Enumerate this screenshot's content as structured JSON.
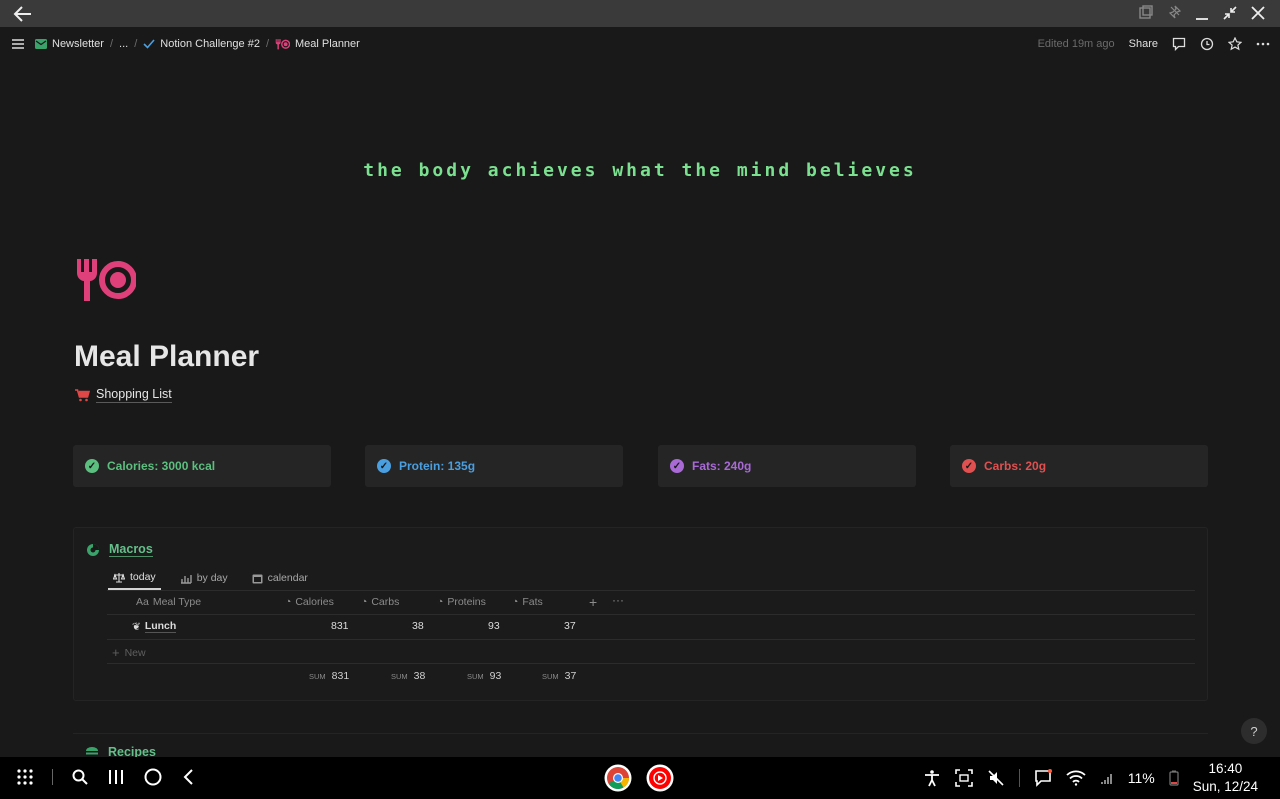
{
  "topbar": {
    "breadcrumbs": [
      "Newsletter",
      "...",
      "Notion Challenge #2",
      "Meal Planner"
    ],
    "edited": "Edited 19m ago",
    "share_label": "Share"
  },
  "cover": {
    "quote": "the body achieves what the mind believes"
  },
  "page": {
    "title": "Meal Planner",
    "link": "Shopping List",
    "icon": "fork-plate-icon"
  },
  "stats": [
    {
      "label": "Calories: 3000 kcal",
      "color": "#5cbf7f"
    },
    {
      "label": "Protein: 135g",
      "color": "#4a9fe0"
    },
    {
      "label": "Fats: 240g",
      "color": "#a96ad6"
    },
    {
      "label": "Carbs: 20g",
      "color": "#e05050"
    }
  ],
  "macros": {
    "title": "Macros",
    "views": [
      "today",
      "by day",
      "calendar"
    ],
    "columns": [
      "Meal Type",
      "Calories",
      "Carbs",
      "Proteins",
      "Fats"
    ],
    "rows": [
      {
        "meal": "Lunch",
        "calories": "831",
        "carbs": "38",
        "proteins": "93",
        "fats": "37"
      }
    ],
    "new_label": "New",
    "sum_label": "SUM",
    "sums": {
      "calories": "831",
      "carbs": "38",
      "proteins": "93",
      "fats": "37"
    }
  },
  "recipes": {
    "title": "Recipes"
  },
  "help_label": "?",
  "system": {
    "battery": "11%",
    "time": "16:40",
    "date": "Sun, 12/24"
  }
}
